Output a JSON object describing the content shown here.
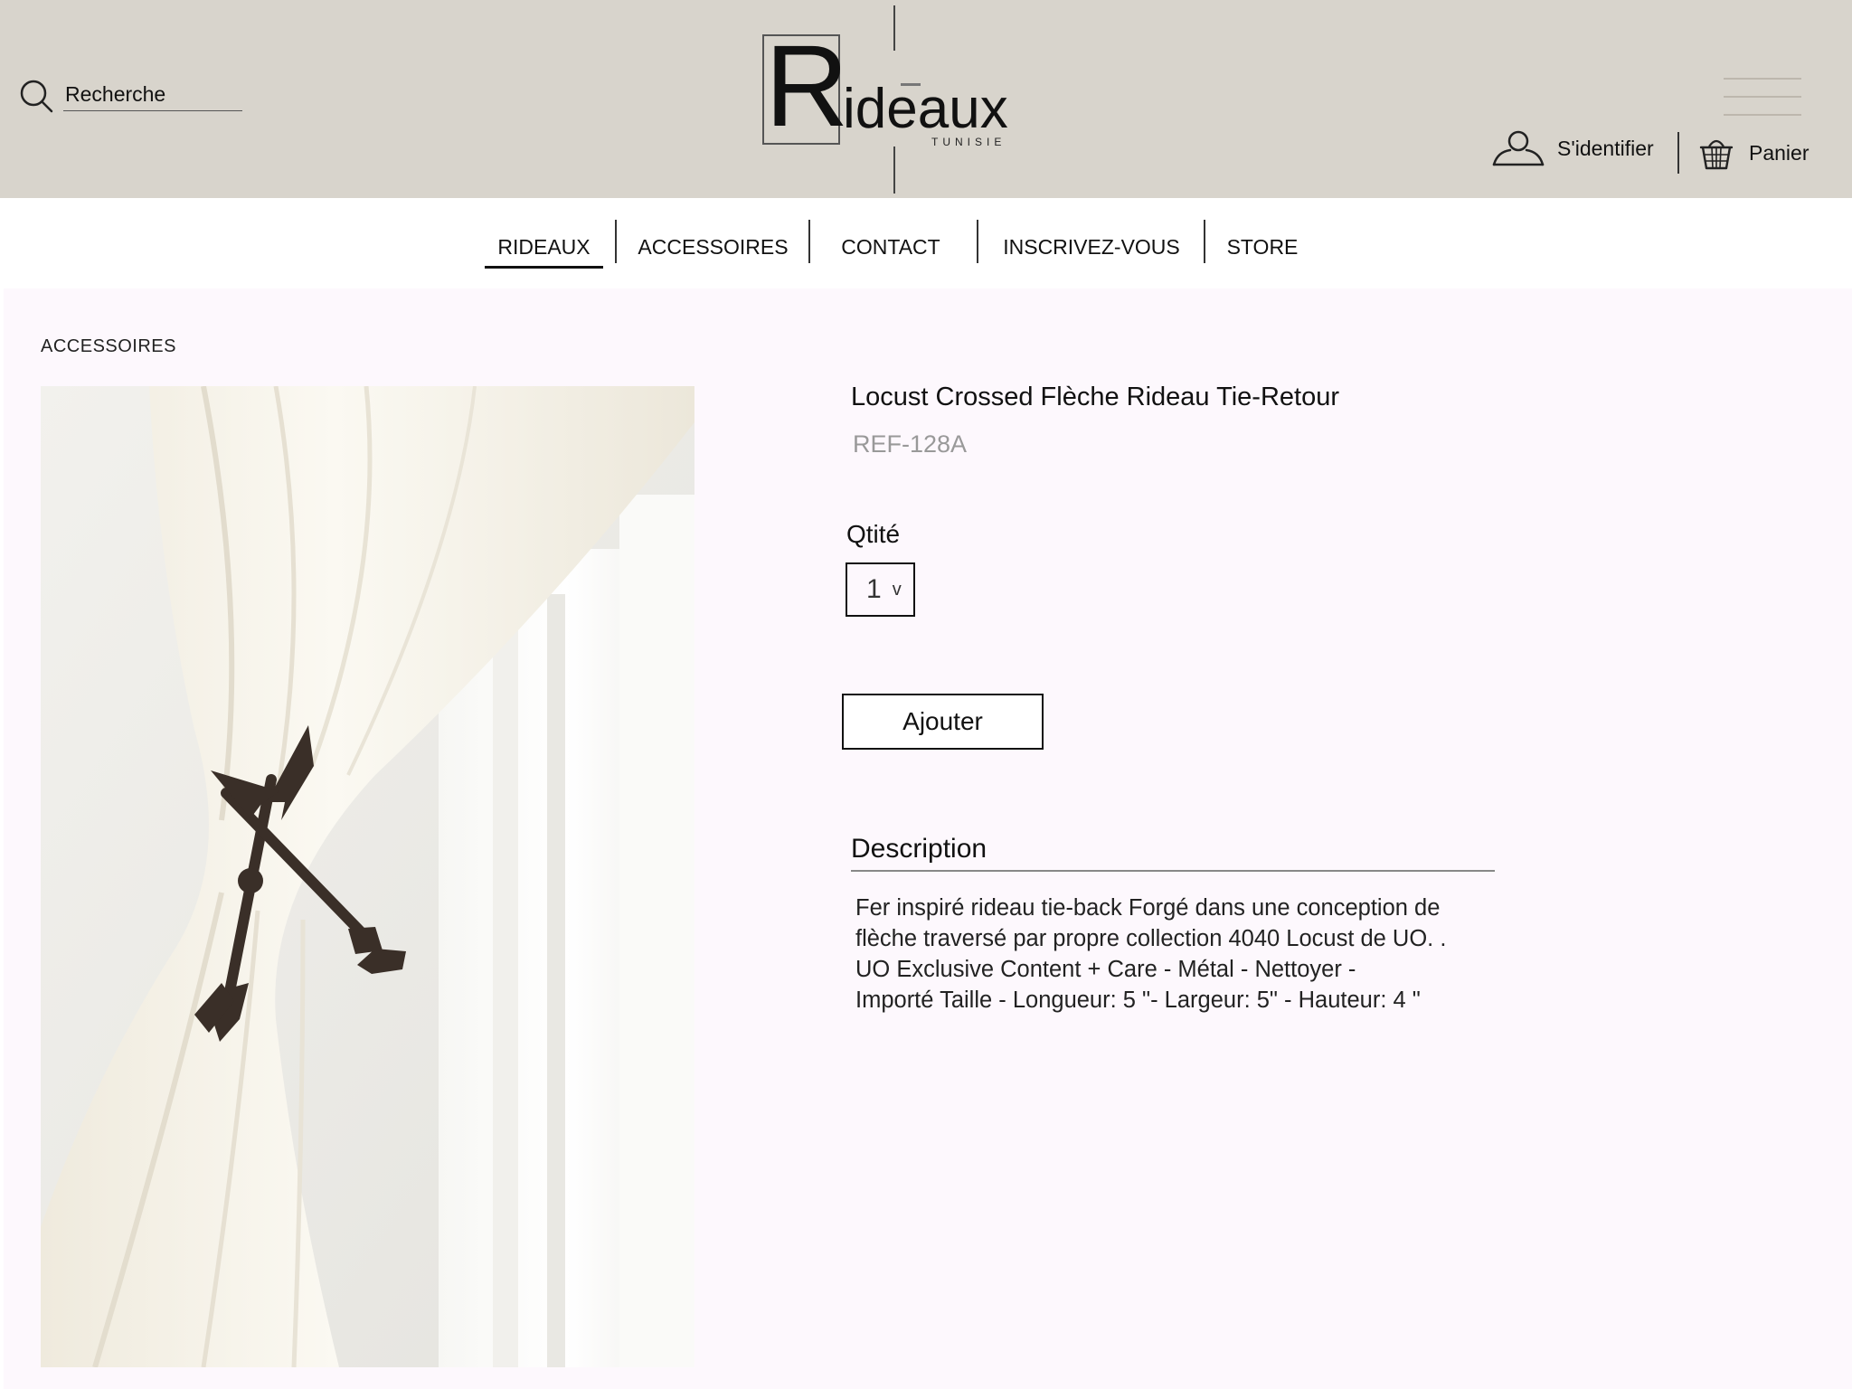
{
  "header": {
    "search_placeholder": "Recherche",
    "logo": {
      "initial": "R",
      "rest": "ideaux",
      "subtitle": "TUNISIE"
    },
    "signin_label": "S'identifier",
    "cart_label": "Panier"
  },
  "nav": {
    "items": [
      {
        "label": "RIDEAUX",
        "active": true
      },
      {
        "label": "ACCESSOIRES",
        "active": false
      },
      {
        "label": "CONTACT",
        "active": false
      },
      {
        "label": "INSCRIVEZ-VOUS",
        "active": false
      },
      {
        "label": "STORE",
        "active": false
      }
    ]
  },
  "breadcrumb": "ACCESSOIRES",
  "product": {
    "title": "Locust Crossed Flèche Rideau Tie-Retour",
    "ref": "REF-128A",
    "qty_label": "Qtité",
    "qty_value": "1",
    "qty_chevron": "v",
    "add_button": "Ajouter",
    "description_title": "Description",
    "description_text": "Fer inspiré rideau tie-back Forgé dans une conception de\n flèche traversé par propre collection 4040 Locust de UO. .\nUO Exclusive Content + Care - Métal - Nettoyer -\nImporté Taille - Longueur: 5 \"- Largeur: 5\" - Hauteur: 4 \""
  },
  "colors": {
    "header_bg": "#d8d4cc",
    "main_bg": "#fdf8fd",
    "ref_gray": "#999999"
  },
  "icons": [
    "search-icon",
    "user-icon",
    "basket-icon",
    "hamburger-icon"
  ]
}
